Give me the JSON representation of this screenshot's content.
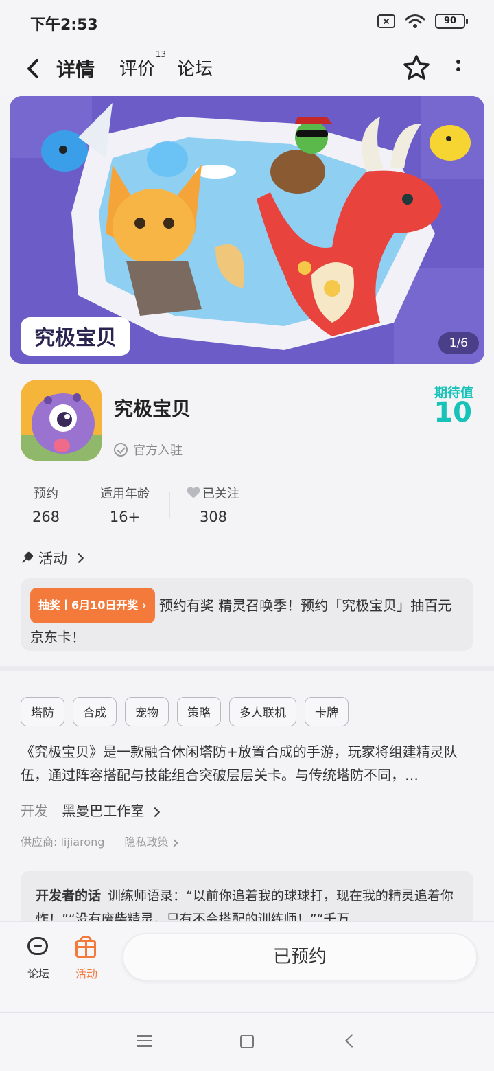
{
  "status_bar": {
    "time": "下午2:53",
    "battery": "90"
  },
  "nav": {
    "tabs": [
      {
        "label": "详情",
        "active": true
      },
      {
        "label": "评价",
        "count": "13"
      },
      {
        "label": "论坛"
      }
    ]
  },
  "banner": {
    "logo_text": "究极宝贝",
    "counter": "1/6"
  },
  "app": {
    "name": "究极宝贝",
    "official_label": "官方入驻",
    "expect_label": "期待值",
    "expect_value": "10"
  },
  "stats": [
    {
      "label": "预约",
      "value": "268"
    },
    {
      "label": "适用年龄",
      "value": "16+"
    },
    {
      "label": "已关注",
      "value": "308"
    }
  ],
  "activity": {
    "header": "活动",
    "tag": "抽奖丨6月10日开奖",
    "text": "预约有奖 精灵召唤季！预约「究极宝贝」抽百元京东卡！"
  },
  "tags": [
    "塔防",
    "合成",
    "宠物",
    "策略",
    "多人联机",
    "卡牌"
  ],
  "description": "《究极宝贝》是一款融合休闲塔防+放置合成的手游，玩家将组建精灵队伍，通过阵容搭配与技能组合突破层层关卡。与传统塔防不同，…",
  "developer": {
    "label": "开发",
    "name": "黑曼巴工作室"
  },
  "supplier": {
    "text": "供应商: lijiarong",
    "privacy": "隐私政策"
  },
  "dev_note": {
    "title": "开发者的话",
    "text": "训练师语录：“以前你追着我的球球打，现在我的精灵追着你炸！”“没有废柴精灵，只有不会搭配的训练师！”“千万"
  },
  "bottom_bar": {
    "forum_label": "论坛",
    "activity_label": "活动",
    "reserve_button": "已预约"
  },
  "colors": {
    "accent_teal": "#17c2b8",
    "accent_orange": "#f47a3c"
  }
}
